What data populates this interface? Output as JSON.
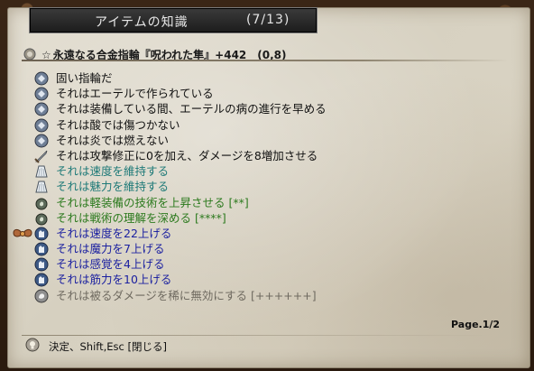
{
  "window": {
    "title": "アイテムの知識",
    "count": "(7/13)"
  },
  "item": {
    "star": "☆",
    "name": "永遠なる合金指輪『呪われた隼』+442　(0,8)"
  },
  "properties": [
    {
      "icon": "gem-icon",
      "text": "固い指輪だ",
      "color": "black"
    },
    {
      "icon": "gem-icon",
      "text": "それはエーテルで作られている",
      "color": "black"
    },
    {
      "icon": "gem-icon",
      "text": "それは装備している間、エーテルの病の進行を早める",
      "color": "black"
    },
    {
      "icon": "gem-icon",
      "text": "それは酸では傷つかない",
      "color": "black"
    },
    {
      "icon": "gem-icon",
      "text": "それは炎では燃えない",
      "color": "black"
    },
    {
      "icon": "sword-icon",
      "text": "それは攻撃修正に0を加え、ダメージを8増加させる",
      "color": "black"
    },
    {
      "icon": "cloak-icon",
      "text": "それは速度を維持する",
      "color": "teal"
    },
    {
      "icon": "cloak-icon",
      "text": "それは魅力を維持する",
      "color": "teal"
    },
    {
      "icon": "potion-icon",
      "text": "それは軽装備の技術を上昇させる [**]",
      "color": "green"
    },
    {
      "icon": "potion-icon",
      "text": "それは戦術の理解を深める [****]",
      "color": "green"
    },
    {
      "icon": "glove-icon",
      "text": "それは速度を22上げる",
      "color": "blue"
    },
    {
      "icon": "glove-icon",
      "text": "それは魔力を7上げる",
      "color": "blue"
    },
    {
      "icon": "glove-icon",
      "text": "それは感覚を4上げる",
      "color": "blue"
    },
    {
      "icon": "glove-icon",
      "text": "それは筋力を10上げる",
      "color": "blue"
    },
    {
      "icon": "scroll-icon",
      "text": "それは被るダメージを稀に無効にする [++++++]",
      "color": "gray"
    }
  ],
  "side_icon": "wing-cursor-icon",
  "page": "Page.1/2",
  "footer": {
    "hint": "決定、Shift,Esc [閉じる]"
  }
}
